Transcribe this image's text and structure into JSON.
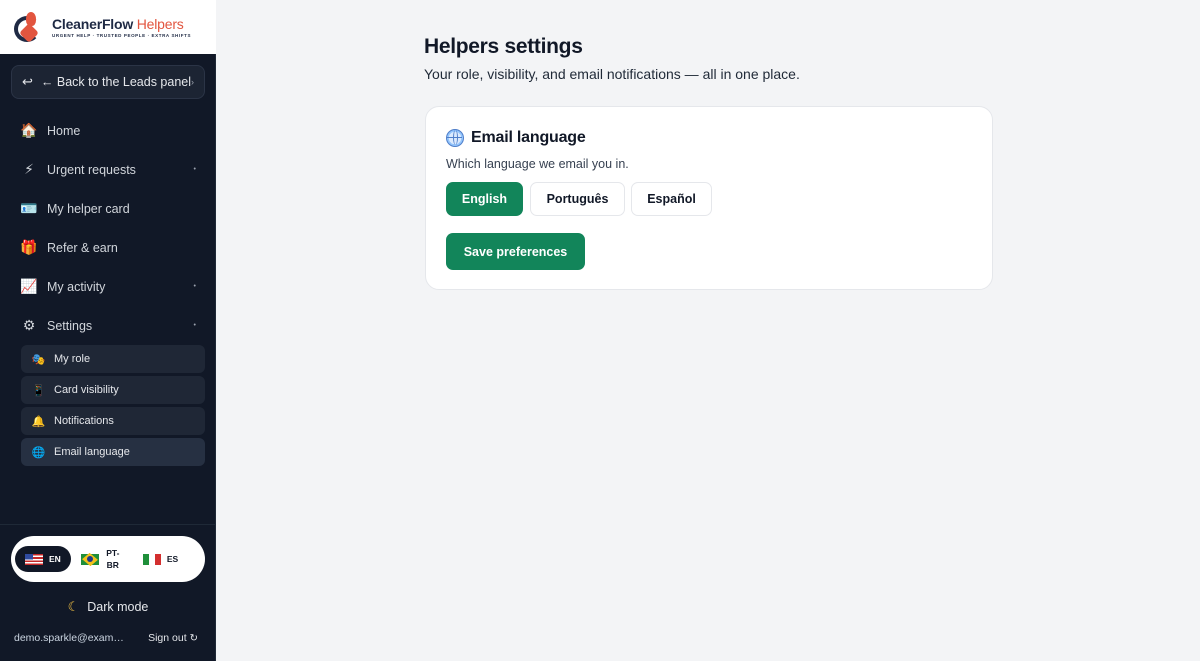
{
  "brand": {
    "name": "CleanerFlow",
    "name_accent": "Helpers",
    "tagline": "URGENT HELP · TRUSTED PEOPLE · EXTRA SHIFTS"
  },
  "sidebar": {
    "back_label": "← Back to the Leads panel",
    "back_icon": "return-arrow-icon",
    "items": [
      {
        "label": "Home",
        "icon": "🏠"
      },
      {
        "label": "Urgent requests",
        "icon": "⚡",
        "expandable": true
      },
      {
        "label": "My helper card",
        "icon": "🪪"
      },
      {
        "label": "Refer & earn",
        "icon": "🎁"
      },
      {
        "label": "My activity",
        "icon": "📈",
        "expandable": true
      },
      {
        "label": "Settings",
        "icon": "⚙",
        "expandable": true
      }
    ],
    "settings_sub": [
      {
        "label": "My role",
        "icon": "🎭"
      },
      {
        "label": "Card visibility",
        "icon": "📱"
      },
      {
        "label": "Notifications",
        "icon": "🔔"
      },
      {
        "label": "Email language",
        "icon": "🌐",
        "active": true
      }
    ],
    "languages": {
      "en": "EN",
      "pt": "PT-BR",
      "pt_line1": "PT-",
      "pt_line2": "BR",
      "es": "ES",
      "selected": "EN"
    },
    "dark_mode_label": "Dark mode",
    "user_email": "demo.sparkle@exampl...",
    "sign_out_label": "Sign out"
  },
  "main": {
    "title": "Helpers settings",
    "subtitle": "Your role, visibility, and email notifications — all in one place.",
    "card": {
      "title": "Email language",
      "description": "Which language we email you in.",
      "options": [
        "English",
        "Português",
        "Español"
      ],
      "selected": "English",
      "save_label": "Save preferences"
    }
  },
  "colors": {
    "sidebar_bg": "#111827",
    "accent_green": "#12855a",
    "brand_red": "#e2553f",
    "brand_navy": "#1f2a44"
  }
}
